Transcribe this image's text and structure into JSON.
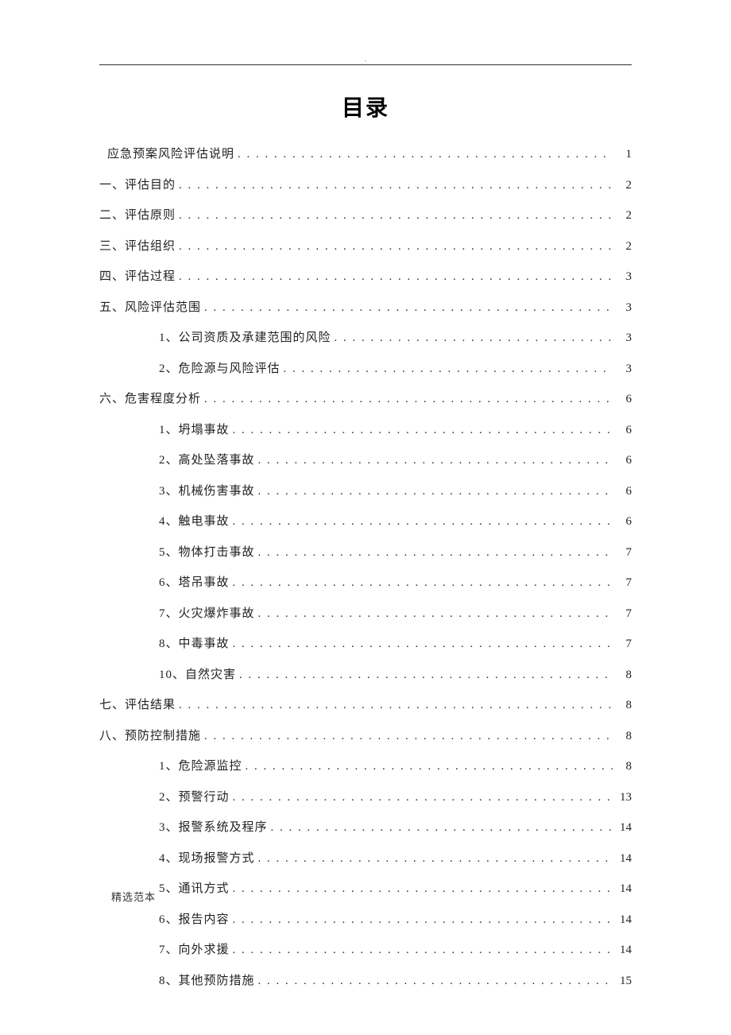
{
  "title": "目录",
  "footer": "精选范本",
  "toc": [
    {
      "level": 0,
      "label": "应急预案风险评估说明",
      "page": "1"
    },
    {
      "level": 1,
      "label": "一、评估目的",
      "page": "2"
    },
    {
      "level": 1,
      "label": "二、评估原则",
      "page": "2"
    },
    {
      "level": 1,
      "label": "三、评估组织",
      "page": "2"
    },
    {
      "level": 1,
      "label": "四、评估过程",
      "page": "3"
    },
    {
      "level": 1,
      "label": "五、风险评估范围",
      "page": "3"
    },
    {
      "level": 2,
      "label": "1、公司资质及承建范围的风险",
      "page": "3"
    },
    {
      "level": 2,
      "label": "2、危险源与风险评估",
      "page": "3"
    },
    {
      "level": 1,
      "label": "六、危害程度分析",
      "page": "6"
    },
    {
      "level": 2,
      "label": "1、坍塌事故",
      "page": "6"
    },
    {
      "level": 2,
      "label": "2、高处坠落事故",
      "page": "6"
    },
    {
      "level": 2,
      "label": "3、机械伤害事故",
      "page": "6"
    },
    {
      "level": 2,
      "label": "4、触电事故",
      "page": "6"
    },
    {
      "level": 2,
      "label": "5、物体打击事故",
      "page": "7"
    },
    {
      "level": 2,
      "label": "6、塔吊事故",
      "page": "7"
    },
    {
      "level": 2,
      "label": "7、火灾爆炸事故",
      "page": "7"
    },
    {
      "level": 2,
      "label": "8、中毒事故",
      "page": "7"
    },
    {
      "level": 2,
      "label": "10、自然灾害",
      "page": "8"
    },
    {
      "level": 1,
      "label": "七、评估结果",
      "page": "8"
    },
    {
      "level": 1,
      "label": "八、预防控制措施",
      "page": "8"
    },
    {
      "level": 2,
      "label": "1、危险源监控",
      "page": "8"
    },
    {
      "level": 2,
      "label": "2、预警行动",
      "page": "13"
    },
    {
      "level": 2,
      "label": "3、报警系统及程序",
      "page": "14"
    },
    {
      "level": 2,
      "label": "4、现场报警方式",
      "page": "14"
    },
    {
      "level": 2,
      "label": "5、通讯方式",
      "page": "14"
    },
    {
      "level": 2,
      "label": "6、报告内容",
      "page": "14"
    },
    {
      "level": 2,
      "label": "7、向外求援",
      "page": "14"
    },
    {
      "level": 2,
      "label": "8、其他预防措施",
      "page": "15"
    }
  ]
}
